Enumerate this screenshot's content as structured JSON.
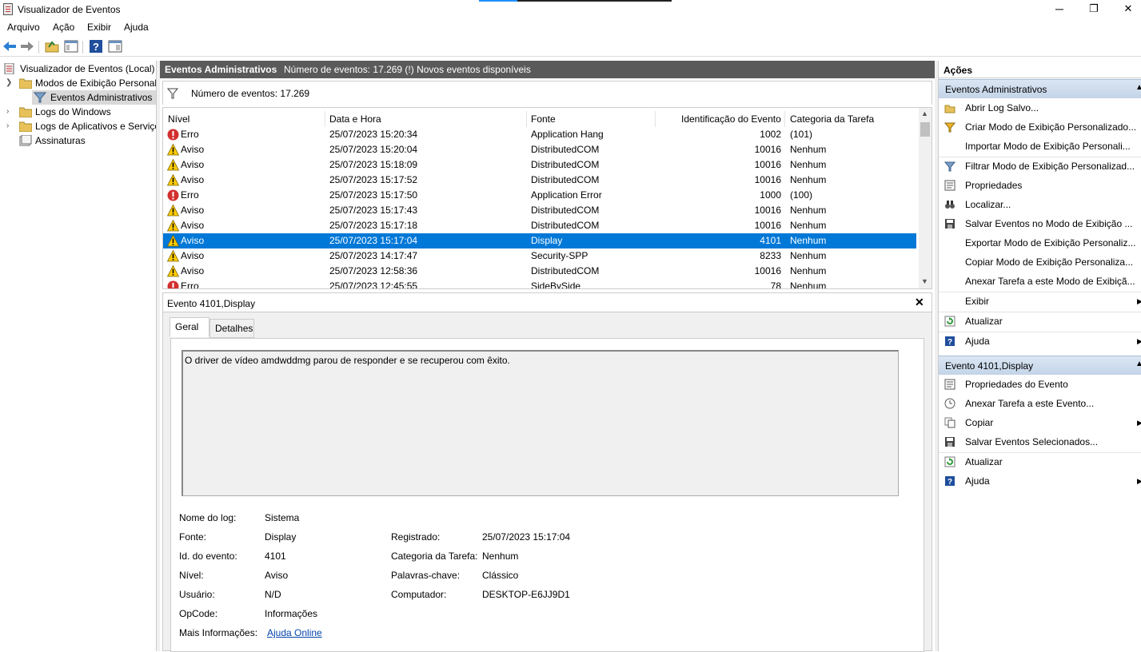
{
  "window": {
    "title": "Visualizador de Eventos",
    "min": "─",
    "max": "❐",
    "close": "✕"
  },
  "menu": [
    "Arquivo",
    "Ação",
    "Exibir",
    "Ajuda"
  ],
  "toolbar": {
    "icons": [
      "back-arrow-icon",
      "forward-arrow-icon",
      "open-folder-icon",
      "show-hide-tree-icon",
      "help-icon",
      "properties-pane-icon"
    ]
  },
  "tree": {
    "root": "Visualizador de Eventos (Local)",
    "custom_views": "Modos de Exibição Personali",
    "admin_events": "Eventos Administrativos",
    "windows_logs": "Logs do Windows",
    "app_logs": "Logs de Aplicativos e Serviço",
    "subscriptions": "Assinaturas"
  },
  "center": {
    "header_title": "Eventos Administrativos",
    "header_count": "Número de eventos: 17.269 (!) Novos eventos disponíveis",
    "filter_text": "Número de eventos: 17.269",
    "columns": [
      "Nível",
      "Data e Hora",
      "Fonte",
      "Identificação do Evento",
      "Categoria da Tarefa"
    ],
    "rows": [
      {
        "level": "Erro",
        "type": "error",
        "date": "25/07/2023 15:20:34",
        "source": "Application Hang",
        "id": "1002",
        "cat": "(101)"
      },
      {
        "level": "Aviso",
        "type": "warning",
        "date": "25/07/2023 15:20:04",
        "source": "DistributedCOM",
        "id": "10016",
        "cat": "Nenhum"
      },
      {
        "level": "Aviso",
        "type": "warning",
        "date": "25/07/2023 15:18:09",
        "source": "DistributedCOM",
        "id": "10016",
        "cat": "Nenhum"
      },
      {
        "level": "Aviso",
        "type": "warning",
        "date": "25/07/2023 15:17:52",
        "source": "DistributedCOM",
        "id": "10016",
        "cat": "Nenhum"
      },
      {
        "level": "Erro",
        "type": "error",
        "date": "25/07/2023 15:17:50",
        "source": "Application Error",
        "id": "1000",
        "cat": "(100)"
      },
      {
        "level": "Aviso",
        "type": "warning",
        "date": "25/07/2023 15:17:43",
        "source": "DistributedCOM",
        "id": "10016",
        "cat": "Nenhum"
      },
      {
        "level": "Aviso",
        "type": "warning",
        "date": "25/07/2023 15:17:18",
        "source": "DistributedCOM",
        "id": "10016",
        "cat": "Nenhum"
      },
      {
        "level": "Aviso",
        "type": "warning",
        "date": "25/07/2023 15:17:04",
        "source": "Display",
        "id": "4101",
        "cat": "Nenhum",
        "selected": true
      },
      {
        "level": "Aviso",
        "type": "warning",
        "date": "25/07/2023 14:17:47",
        "source": "Security-SPP",
        "id": "8233",
        "cat": "Nenhum"
      },
      {
        "level": "Aviso",
        "type": "warning",
        "date": "25/07/2023 12:58:36",
        "source": "DistributedCOM",
        "id": "10016",
        "cat": "Nenhum"
      },
      {
        "level": "Erro",
        "type": "error",
        "date": "25/07/2023 12:45:55",
        "source": "SideBySide",
        "id": "78",
        "cat": "Nenhum"
      }
    ]
  },
  "detail": {
    "title": "Evento 4101,Display",
    "close": "✕",
    "tab_general": "Geral",
    "tab_details": "Detalhes",
    "description": "O driver de vídeo amdwddmg parou de responder e se recuperou com êxito.",
    "fields": {
      "log_name_label": "Nome do log:",
      "log_name": "Sistema",
      "source_label": "Fonte:",
      "source": "Display",
      "logged_label": "Registrado:",
      "logged": "25/07/2023 15:17:04",
      "event_id_label": "Id. do evento:",
      "event_id": "4101",
      "task_label": "Categoria da Tarefa:",
      "task": "Nenhum",
      "level_label": "Nível:",
      "level": "Aviso",
      "keywords_label": "Palavras-chave:",
      "keywords": "Clássico",
      "user_label": "Usuário:",
      "user": "N/D",
      "computer_label": "Computador:",
      "computer": "DESKTOP-E6JJ9D1",
      "opcode_label": "OpCode:",
      "opcode": "Informações",
      "more_info_label": "Mais Informações:",
      "more_info": "Ajuda Online"
    }
  },
  "actions": {
    "title": "Ações",
    "section1": "Eventos Administrativos",
    "items1": [
      {
        "label": "Abrir Log Salvo...",
        "icon": "open-folder-icon"
      },
      {
        "label": "Criar Modo de Exibição Personalizado...",
        "icon": "create-filter-icon"
      },
      {
        "label": "Importar Modo de Exibição Personali...",
        "icon": ""
      },
      {
        "label": "Filtrar Modo de Exibição Personalizad...",
        "icon": "filter-icon"
      },
      {
        "label": "Propriedades",
        "icon": "properties-icon"
      },
      {
        "label": "Localizar...",
        "icon": "binoculars-icon"
      },
      {
        "label": "Salvar Eventos no Modo de Exibição ...",
        "icon": "save-icon"
      },
      {
        "label": "Exportar Modo de Exibição Personaliz...",
        "icon": ""
      },
      {
        "label": "Copiar Modo de Exibição Personaliza...",
        "icon": ""
      },
      {
        "label": "Anexar Tarefa a este Modo de Exibiçã...",
        "icon": ""
      },
      {
        "label": "Exibir",
        "icon": "",
        "submenu": true
      },
      {
        "label": "Atualizar",
        "icon": "refresh-icon"
      },
      {
        "label": "Ajuda",
        "icon": "help-icon",
        "submenu": true
      }
    ],
    "section2": "Evento 4101,Display",
    "items2": [
      {
        "label": "Propriedades do Evento",
        "icon": "properties-icon"
      },
      {
        "label": "Anexar Tarefa a este Evento...",
        "icon": "task-icon"
      },
      {
        "label": "Copiar",
        "icon": "copy-icon",
        "submenu": true
      },
      {
        "label": "Salvar Eventos Selecionados...",
        "icon": "save-icon"
      },
      {
        "label": "Atualizar",
        "icon": "refresh-icon"
      },
      {
        "label": "Ajuda",
        "icon": "help-icon",
        "submenu": true
      }
    ]
  },
  "colors": {
    "selection": "#0078d7",
    "header_dark": "#5a5a5a",
    "section_blue": "#c3d4e8",
    "error_red": "#d32f2f",
    "warning_yellow": "#ffcc00"
  }
}
